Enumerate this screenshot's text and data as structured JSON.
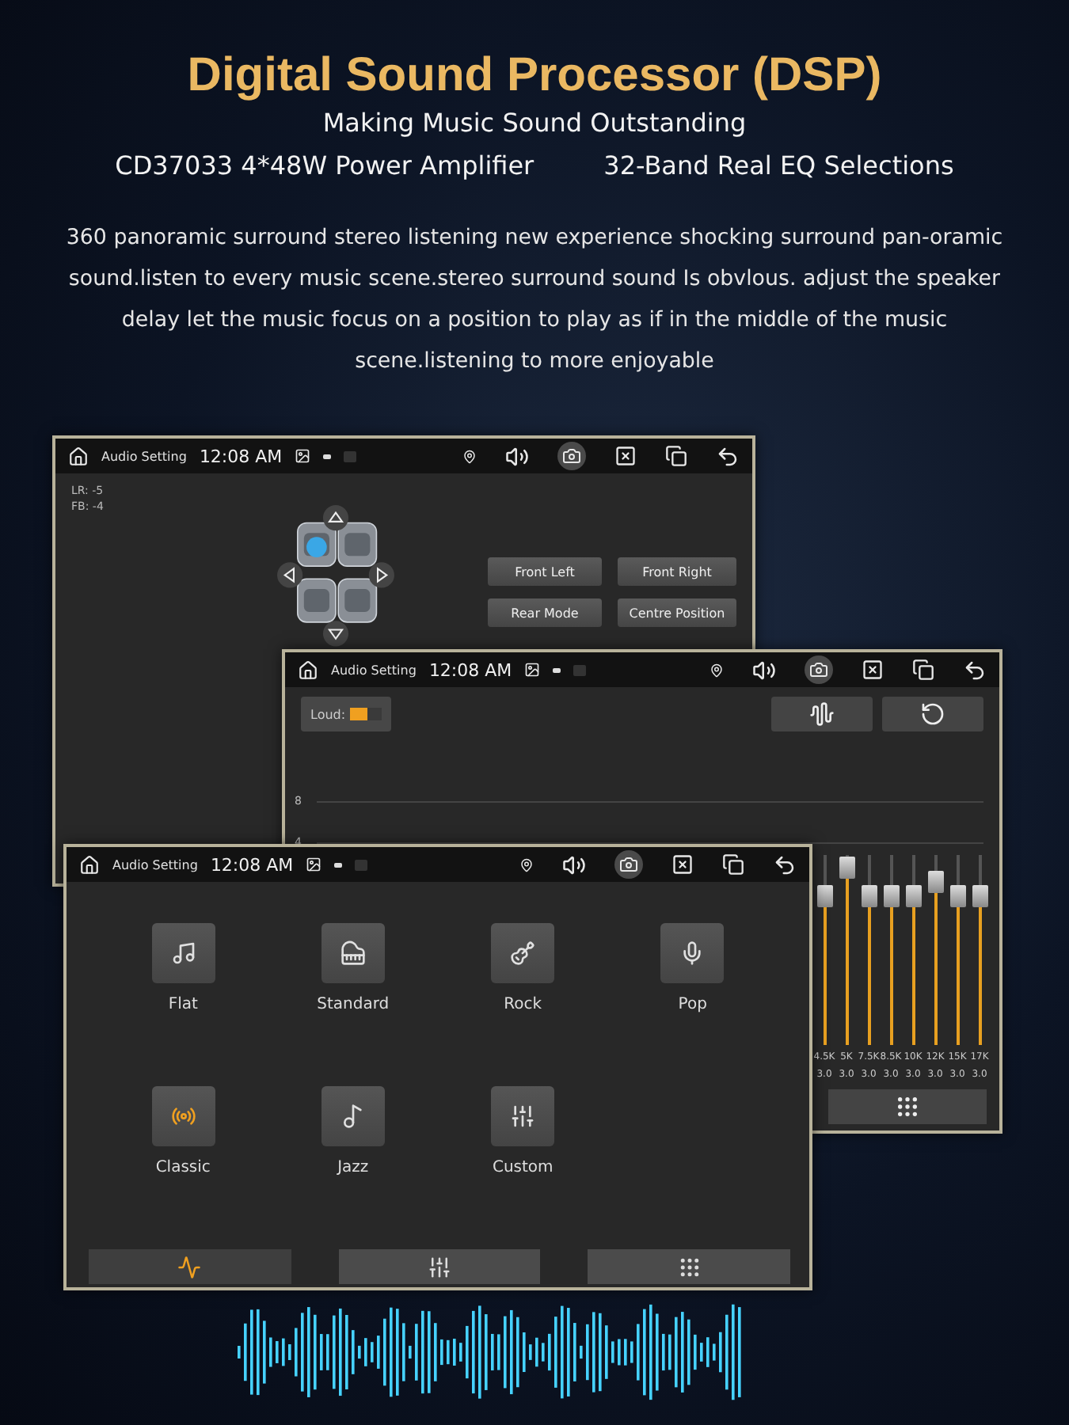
{
  "header": {
    "title": "Digital Sound Processor (DSP)",
    "subtitle": "Making Music Sound Outstanding",
    "features": [
      "CD37033 4*48W Power Amplifier",
      "32-Band Real EQ Selections"
    ],
    "description": "360 panoramic surround stereo listening new experience shocking surround pan-oramic sound.listen to every music scene.stereo surround sound Is obvlous. adjust the speaker delay let the music focus on a position to play as if in the middle of the music scene.listening to more enjoyable"
  },
  "windows": [
    {
      "kind": "balance",
      "status_bar": {
        "app_title": "Audio Setting",
        "time": "12:08 AM"
      },
      "readouts": [
        "LR: -5",
        "FB: -4"
      ],
      "buttons": [
        "Front Left",
        "Front Right",
        "Rear Mode",
        "Centre Position"
      ]
    },
    {
      "kind": "eq",
      "status_bar": {
        "app_title": "Audio Setting",
        "time": "12:08 AM"
      },
      "loud": {
        "label": "Loud:",
        "on": true
      },
      "graph_ticks": [
        "8",
        "4"
      ],
      "bands": [
        {
          "label": "4.5K",
          "value": "3.0",
          "level": 0.78
        },
        {
          "label": "5K",
          "value": "3.0",
          "level": 0.93
        },
        {
          "label": "7.5K",
          "value": "3.0",
          "level": 0.78
        },
        {
          "label": "8.5K",
          "value": "3.0",
          "level": 0.78
        },
        {
          "label": "10K",
          "value": "3.0",
          "level": 0.78
        },
        {
          "label": "12K",
          "value": "3.0",
          "level": 0.86
        },
        {
          "label": "15K",
          "value": "3.0",
          "level": 0.78
        },
        {
          "label": "17K",
          "value": "3.0",
          "level": 0.78
        }
      ]
    },
    {
      "kind": "presets",
      "status_bar": {
        "app_title": "Audio Setting",
        "time": "12:08 AM"
      },
      "presets": [
        {
          "label": "Flat",
          "selected": false
        },
        {
          "label": "Standard",
          "selected": false
        },
        {
          "label": "Rock",
          "selected": false
        },
        {
          "label": "Pop",
          "selected": false
        },
        {
          "label": "Classic",
          "selected": true
        },
        {
          "label": "Jazz",
          "selected": false
        },
        {
          "label": "Custom",
          "selected": false
        }
      ],
      "tabs": [
        {
          "selected": true
        },
        {
          "selected": false
        },
        {
          "selected": false
        }
      ]
    }
  ]
}
